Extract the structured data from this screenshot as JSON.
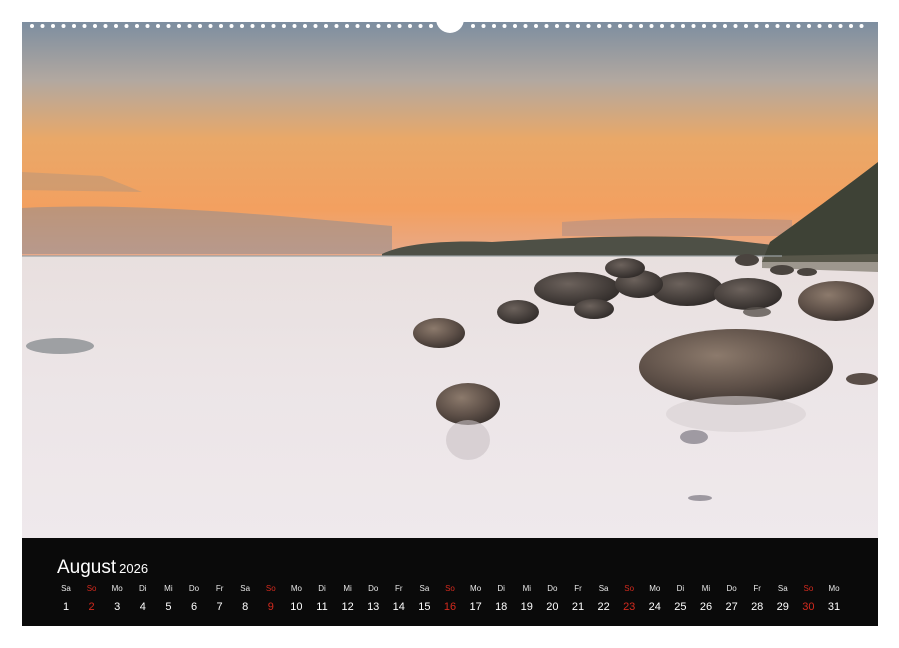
{
  "calendar": {
    "month": "August",
    "year": "2026",
    "sunday_color": "#d42a1e",
    "days": [
      {
        "wd": "Sa",
        "n": "1",
        "sun": false
      },
      {
        "wd": "So",
        "n": "2",
        "sun": true
      },
      {
        "wd": "Mo",
        "n": "3",
        "sun": false
      },
      {
        "wd": "Di",
        "n": "4",
        "sun": false
      },
      {
        "wd": "Mi",
        "n": "5",
        "sun": false
      },
      {
        "wd": "Do",
        "n": "6",
        "sun": false
      },
      {
        "wd": "Fr",
        "n": "7",
        "sun": false
      },
      {
        "wd": "Sa",
        "n": "8",
        "sun": false
      },
      {
        "wd": "So",
        "n": "9",
        "sun": true
      },
      {
        "wd": "Mo",
        "n": "10",
        "sun": false
      },
      {
        "wd": "Di",
        "n": "11",
        "sun": false
      },
      {
        "wd": "Mi",
        "n": "12",
        "sun": false
      },
      {
        "wd": "Do",
        "n": "13",
        "sun": false
      },
      {
        "wd": "Fr",
        "n": "14",
        "sun": false
      },
      {
        "wd": "Sa",
        "n": "15",
        "sun": false
      },
      {
        "wd": "So",
        "n": "16",
        "sun": true
      },
      {
        "wd": "Mo",
        "n": "17",
        "sun": false
      },
      {
        "wd": "Di",
        "n": "18",
        "sun": false
      },
      {
        "wd": "Mi",
        "n": "19",
        "sun": false
      },
      {
        "wd": "Do",
        "n": "20",
        "sun": false
      },
      {
        "wd": "Fr",
        "n": "21",
        "sun": false
      },
      {
        "wd": "Sa",
        "n": "22",
        "sun": false
      },
      {
        "wd": "So",
        "n": "23",
        "sun": true
      },
      {
        "wd": "Mo",
        "n": "24",
        "sun": false
      },
      {
        "wd": "Di",
        "n": "25",
        "sun": false
      },
      {
        "wd": "Mi",
        "n": "26",
        "sun": false
      },
      {
        "wd": "Do",
        "n": "27",
        "sun": false
      },
      {
        "wd": "Fr",
        "n": "28",
        "sun": false
      },
      {
        "wd": "Sa",
        "n": "29",
        "sun": false
      },
      {
        "wd": "So",
        "n": "30",
        "sun": true
      },
      {
        "wd": "Mo",
        "n": "31",
        "sun": false
      }
    ]
  },
  "photo": {
    "subject": "coastal-sunset-rocks-photo"
  }
}
